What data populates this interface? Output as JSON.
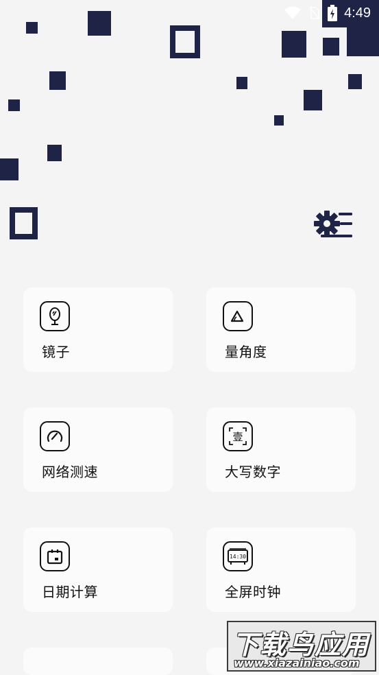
{
  "status_bar": {
    "time": "4:49",
    "icons": [
      "wifi-icon",
      "no-sim-icon",
      "battery-charging-icon"
    ]
  },
  "header": {
    "settings_icon": "settings-menu-icon"
  },
  "tools": [
    {
      "label": "镜子",
      "icon": "mirror-icon"
    },
    {
      "label": "量角度",
      "icon": "angle-icon"
    },
    {
      "label": "网络测速",
      "icon": "speedometer-icon"
    },
    {
      "label": "大写数字",
      "icon": "capital-number-icon"
    },
    {
      "label": "日期计算",
      "icon": "calendar-icon"
    },
    {
      "label": "全屏时钟",
      "icon": "fullscreen-clock-icon"
    }
  ],
  "icon_texts": {
    "capital_number": "壹",
    "clock_time": "14:30"
  },
  "watermark": {
    "title": "下载鸟应用",
    "url": "www.xiazainiao.com"
  },
  "colors": {
    "background": "#f4f4f4",
    "card": "#fbfbfb",
    "accent_navy": "#1f2447",
    "text": "#111111"
  }
}
